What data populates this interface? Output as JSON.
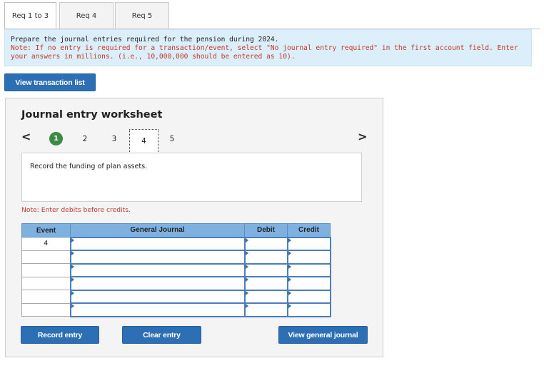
{
  "tabs": [
    {
      "label": "Req 1 to 3",
      "active": true
    },
    {
      "label": "Req 4",
      "active": false
    },
    {
      "label": "Req 5",
      "active": false
    }
  ],
  "instructions": {
    "line1": "Prepare the journal entries required for the pension during 2024.",
    "note": "Note: If no entry is required for a transaction/event, select \"No journal entry required\" in the first account field. Enter your answers in millions. (i.e., 10,000,000 should be entered as 10)."
  },
  "view_transaction_list_label": "View transaction list",
  "worksheet": {
    "title": "Journal entry worksheet",
    "prev_arrow": "<",
    "next_arrow": ">",
    "steps": [
      "1",
      "2",
      "3",
      "4",
      "5"
    ],
    "completed_step": "1",
    "current_step": "4",
    "description": "Record the funding of plan assets.",
    "debits_note": "Note: Enter debits before credits.",
    "table": {
      "headers": {
        "event": "Event",
        "journal": "General Journal",
        "debit": "Debit",
        "credit": "Credit"
      },
      "rows": [
        {
          "event": "4",
          "account": "",
          "debit": "",
          "credit": ""
        },
        {
          "event": "",
          "account": "",
          "debit": "",
          "credit": ""
        },
        {
          "event": "",
          "account": "",
          "debit": "",
          "credit": ""
        },
        {
          "event": "",
          "account": "",
          "debit": "",
          "credit": ""
        },
        {
          "event": "",
          "account": "",
          "debit": "",
          "credit": ""
        },
        {
          "event": "",
          "account": "",
          "debit": "",
          "credit": ""
        }
      ]
    },
    "buttons": {
      "record": "Record entry",
      "clear": "Clear entry",
      "view_journal": "View general journal"
    }
  }
}
